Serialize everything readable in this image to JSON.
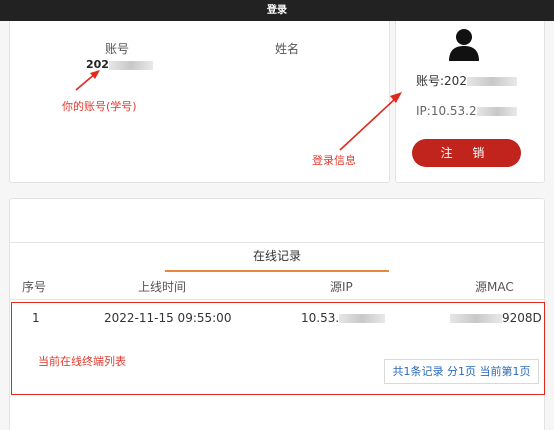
{
  "titlebar": {
    "title": "登录"
  },
  "user_card": {
    "account_label": "账号",
    "account_value": "202",
    "name_label": "姓名"
  },
  "annotations": {
    "account_hint": "你的账号(学号)",
    "login_info_hint": "登录信息",
    "online_terminals_hint": "当前在线终端列表"
  },
  "login_card": {
    "account_text": "账号:202",
    "ip_text": "IP:10.53.2",
    "logout_label": "注 销"
  },
  "records": {
    "tab_label": "在线记录",
    "columns": [
      "序号",
      "上线时间",
      "源IP",
      "源MAC"
    ],
    "rows": [
      {
        "index": "1",
        "time": "2022-11-15 09:55:00",
        "ip": "10.53.",
        "mac": "9208D"
      }
    ],
    "pager": "共1条记录 分1页 当前第1页"
  },
  "colors": {
    "accent_red": "#c0241c",
    "annotation_red": "#e23a2e",
    "tab_underline": "#e8873a",
    "pager_text": "#2a6ab8"
  },
  "icons": {
    "avatar": "user-avatar-icon"
  }
}
